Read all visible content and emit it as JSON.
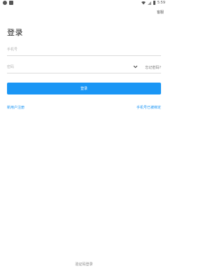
{
  "status_bar": {
    "time": "5:59",
    "left_icons": [
      "chat-notification-icon",
      "app-notification-icon"
    ],
    "right_icons": [
      "wifi-icon",
      "signal-icon",
      "battery-icon"
    ]
  },
  "header": {
    "help_label": "客服"
  },
  "main": {
    "title": "登录",
    "phone_placeholder": "手机号",
    "password_placeholder": "密码",
    "forgot_label": "忘记密码?",
    "login_button": "登录",
    "register_link": "新用户注册",
    "phone_unbound_link": "手机号已被绑定",
    "verify_login_link": "验证码登录"
  },
  "colors": {
    "accent": "#1a96f5",
    "text": "#222222",
    "muted": "#888888"
  }
}
